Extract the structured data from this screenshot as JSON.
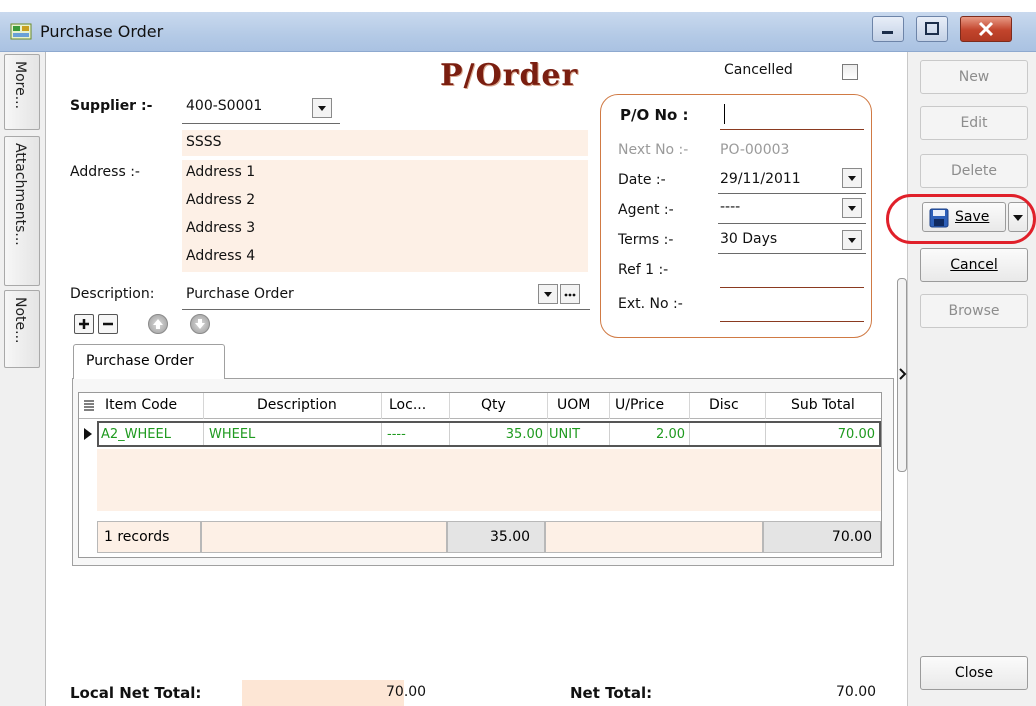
{
  "window": {
    "title": "Purchase Order"
  },
  "side_tabs": [
    "More...",
    "Attachments...",
    "Note..."
  ],
  "header": {
    "doc_title": "P/Order",
    "cancelled_label": "Cancelled"
  },
  "supplier": {
    "label": "Supplier :-",
    "value": "400-S0001",
    "name": "SSSS",
    "address_label": "Address :-",
    "address": [
      "Address 1",
      "Address 2",
      "Address 3",
      "Address 4"
    ]
  },
  "description": {
    "label": "Description:",
    "value": "Purchase Order"
  },
  "po_box": {
    "po_no_label": "P/O No :",
    "po_no_value": "",
    "next_no_label": "Next No :-",
    "next_no_value": "PO-00003",
    "date_label": "Date :-",
    "date_value": "29/11/2011",
    "agent_label": "Agent :-",
    "agent_value": "----",
    "terms_label": "Terms :-",
    "terms_value": "30 Days",
    "ref1_label": "Ref 1 :-",
    "extno_label": "Ext. No :-"
  },
  "tabs": {
    "active": "Purchase Order"
  },
  "grid": {
    "columns": [
      "Item Code",
      "Description",
      "Loc...",
      "Qty",
      "UOM",
      "U/Price",
      "Disc",
      "Sub Total"
    ],
    "rows": [
      {
        "item_code": "A2_WHEEL",
        "description": "WHEEL",
        "loc": "----",
        "qty": "35.00",
        "uom": "UNIT",
        "uprice": "2.00",
        "disc": "",
        "subtotal": "70.00"
      }
    ],
    "footer": {
      "records": "1 records",
      "qty_total": "35.00",
      "subtotal_total": "70.00"
    }
  },
  "buttons": {
    "new": "New",
    "edit": "Edit",
    "delete": "Delete",
    "save": "Save",
    "cancel": "Cancel",
    "browse": "Browse",
    "close": "Close"
  },
  "totals": {
    "local_net_label": "Local Net Total:",
    "local_net_value": "70.00",
    "net_label": "Net Total:",
    "net_value": "70.00"
  },
  "colors": {
    "accent_red": "#e0202a",
    "title_brown": "#7a1e10",
    "field_fill": "#fdf0e6",
    "grid_text_green": "#1f9a1f"
  }
}
